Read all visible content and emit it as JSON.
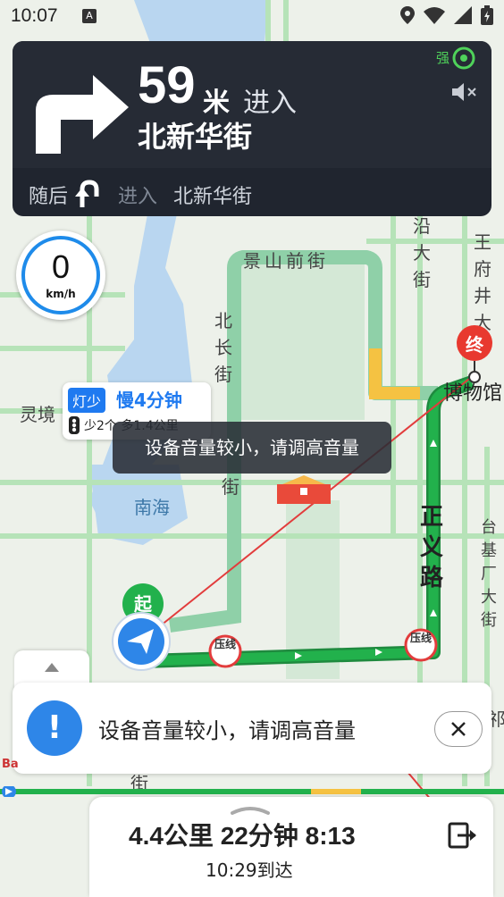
{
  "status_bar": {
    "time": "10:07",
    "app_badge": "A"
  },
  "navigation": {
    "distance": "59",
    "unit": "米",
    "action": "进入",
    "road": "北新华街",
    "signal_label": "强",
    "then_label": "随后",
    "then_action": "进入",
    "then_road": "北新华街"
  },
  "speed": {
    "value": "0",
    "unit": "km/h"
  },
  "map_labels": {
    "jingshan": "景山前街",
    "beichang": "北长街",
    "nanchang": "街",
    "wangfujing": "王府井大",
    "yanyan": "沿大街",
    "museum": "博物馆",
    "zhengyi": "正义路",
    "nanhai": "南海",
    "lingjing": "灵境",
    "taiji": "台基厂大街",
    "qi": "祁",
    "jie": "街",
    "start_marker": "起",
    "end_marker": "终",
    "pressure_line": "压线",
    "baidu_logo": "Ba"
  },
  "route_bubble": {
    "tag": "灯少",
    "time": "慢4分钟",
    "sub": "少2个 多1.4公里"
  },
  "toast": "设备音量较小，请调高音量",
  "banner": {
    "icon": "!",
    "message": "设备音量较小，请调高音量",
    "close_icon": "close-icon"
  },
  "bottom_panel": {
    "summary": "4.4公里 22分钟 8:13",
    "arrival": "10:29到达"
  },
  "colors": {
    "route_green": "#22b14c",
    "route_yellow": "#f5c242",
    "accent_blue": "#1f7af0",
    "end_red": "#e8392f"
  }
}
